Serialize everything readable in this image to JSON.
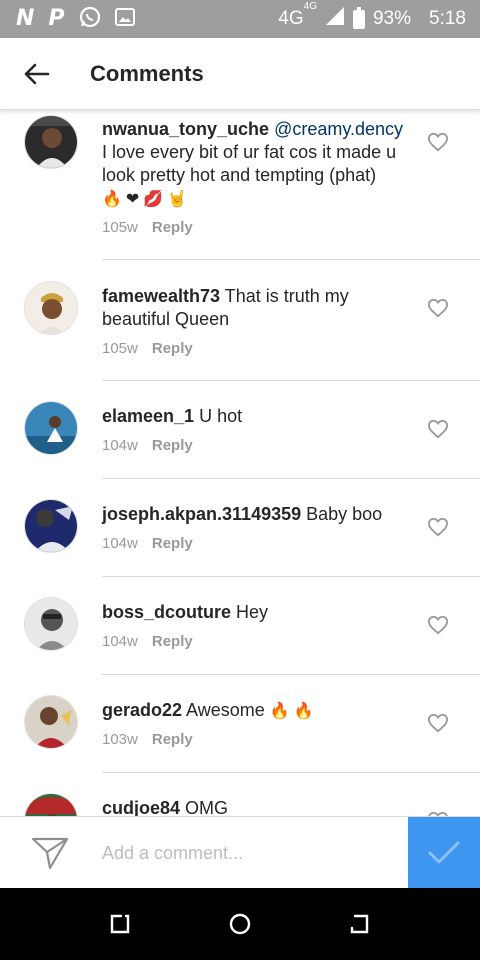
{
  "status_bar": {
    "icons_left": [
      "n-icon",
      "p-icon",
      "whatsapp-icon",
      "gallery-icon"
    ],
    "network": "4G",
    "network_sup": "4G",
    "battery": "93%",
    "time": "5:18"
  },
  "header": {
    "title": "Comments"
  },
  "comments": [
    {
      "username": "nwanua_tony_uche",
      "mention": "@creamy.dency",
      "text": " I love every bit of ur fat cos it made u look pretty hot and tempting (phat)",
      "emojis": [
        "🔥",
        "❤",
        "💋",
        "🤘"
      ],
      "time": "105w",
      "reply": "Reply"
    },
    {
      "username": "famewealth73",
      "mention": "",
      "text": " That is truth my beautiful Queen",
      "emojis": [],
      "time": "105w",
      "reply": "Reply"
    },
    {
      "username": "elameen_1",
      "mention": "",
      "text": " U hot",
      "emojis": [],
      "time": "104w",
      "reply": "Reply"
    },
    {
      "username": "joseph.akpan.31149359",
      "mention": "",
      "text": " Baby boo",
      "emojis": [],
      "time": "104w",
      "reply": "Reply"
    },
    {
      "username": "boss_dcouture",
      "mention": "",
      "text": " Hey",
      "emojis": [],
      "time": "104w",
      "reply": "Reply"
    },
    {
      "username": "gerado22",
      "mention": "",
      "text": " Awesome",
      "emojis": [
        "🔥",
        "🔥"
      ],
      "time": "103w",
      "reply": "Reply"
    },
    {
      "username": "cudjoe84",
      "mention": "",
      "text": " OMG",
      "emojis": [],
      "time": "",
      "reply": ""
    }
  ],
  "compose": {
    "placeholder": "Add a comment..."
  },
  "colors": {
    "post_button": "#3f96f0",
    "mention": "#003569",
    "meta": "#999999"
  }
}
